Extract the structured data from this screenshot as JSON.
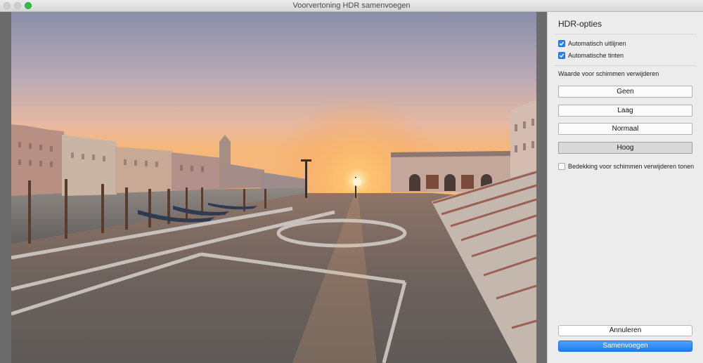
{
  "window": {
    "title": "Voorvertoning HDR samenvoegen"
  },
  "panel": {
    "title": "HDR-opties",
    "auto_align": {
      "label": "Automatisch uitlijnen",
      "checked": true
    },
    "auto_tone": {
      "label": "Automatische tinten",
      "checked": true
    },
    "deghost_label": "Waarde voor schimmen verwijderen",
    "deghost_options": [
      {
        "label": "Geen",
        "selected": false
      },
      {
        "label": "Laag",
        "selected": false
      },
      {
        "label": "Normaal",
        "selected": false
      },
      {
        "label": "Hoog",
        "selected": true
      }
    ],
    "show_overlay": {
      "label": "Bedekking voor schimmen verwijderen tonen",
      "checked": false
    },
    "cancel_label": "Annuleren",
    "merge_label": "Samenvoegen"
  },
  "colors": {
    "accent": "#1f7cf0",
    "sky_top": "#8b8fa8",
    "sunset": "#f4a765"
  }
}
